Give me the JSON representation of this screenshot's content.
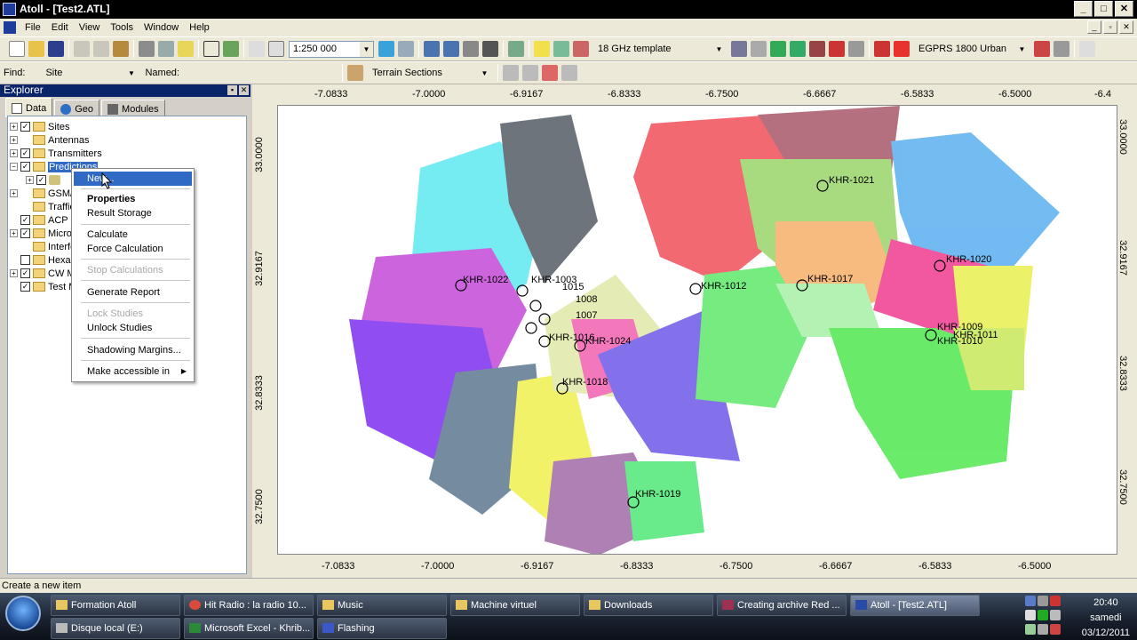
{
  "window": {
    "title": "Atoll - [Test2.ATL]",
    "buttons": [
      "_",
      "□",
      "✕"
    ]
  },
  "menubar": {
    "items": [
      "File",
      "Edit",
      "View",
      "Tools",
      "Window",
      "Help"
    ]
  },
  "toolbar1": {
    "scale_value": "1:250 000",
    "template_value": "18 GHz template",
    "network_value": "EGPRS 1800 Urban"
  },
  "toolbar2": {
    "find_label": "Find:",
    "find_value": "Site",
    "named_label": "Named:",
    "terrain_value": "Terrain Sections"
  },
  "explorer": {
    "title": "Explorer",
    "tabs": [
      "Data",
      "Geo",
      "Modules"
    ],
    "tree": [
      {
        "label": "Sites",
        "checked": true
      },
      {
        "label": "Antennas",
        "checked": false
      },
      {
        "label": "Transmitters",
        "checked": true
      },
      {
        "label": "Predictions",
        "checked": true,
        "selected": true
      },
      {
        "label": "",
        "checked": true
      },
      {
        "label": "GSM/GPRS/EGPRS Parameters",
        "checked": false
      },
      {
        "label": "Traffic Analysis",
        "checked": false
      },
      {
        "label": "ACP - Automatic Cell Planning",
        "checked": true
      },
      {
        "label": "Microwave Radio Links",
        "checked": true
      },
      {
        "label": "Interference Matrices",
        "checked": false
      },
      {
        "label": "Hexagonal Design",
        "checked": false
      },
      {
        "label": "CW Measurements",
        "checked": true
      },
      {
        "label": "Test Mobile Data",
        "checked": true
      }
    ]
  },
  "context_menu": {
    "items": [
      {
        "label": "New...",
        "state": "selected"
      },
      {
        "label": "Properties",
        "state": "bold"
      },
      {
        "label": "Result Storage",
        "state": "normal"
      },
      {
        "label": "Calculate",
        "state": "normal"
      },
      {
        "label": "Force Calculation",
        "state": "normal"
      },
      {
        "label": "Stop Calculations",
        "state": "disabled"
      },
      {
        "label": "Generate Report",
        "state": "normal"
      },
      {
        "label": "Lock Studies",
        "state": "disabled"
      },
      {
        "label": "Unlock Studies",
        "state": "normal"
      },
      {
        "label": "Shadowing Margins...",
        "state": "normal"
      },
      {
        "label": "Make accessible in",
        "state": "submenu"
      }
    ]
  },
  "map": {
    "top_ruler": [
      "-7.0833",
      "-7.0000",
      "-6.9167",
      "-6.8333",
      "-6.7500",
      "-6.6667",
      "-6.5833",
      "-6.5000",
      "-6.4"
    ],
    "bottom_ruler": [
      "-7.0833",
      "-7.0000",
      "-6.9167",
      "-6.8333",
      "-6.7500",
      "-6.6667",
      "-6.5833",
      "-6.5000"
    ],
    "left_ruler": [
      "33.0000",
      "32.9167",
      "32.8333",
      "32.7500"
    ],
    "right_ruler": [
      "33.0000",
      "32.9167",
      "32.8333",
      "32.7500"
    ],
    "site_labels": [
      "KHR-1021",
      "KHR-1020",
      "KHR-1022",
      "KHR-1003",
      "1015",
      "1008",
      "1007",
      "KHR-1012",
      "KHR-1017",
      "KHR-1009",
      "KHR-1011",
      "KHR-1010",
      "KHR-1016",
      "KHR-1024",
      "KHR-1018",
      "KHR-1019"
    ]
  },
  "statusbar": {
    "text": "Create a new item"
  },
  "taskbar": {
    "row1": [
      "Formation Atoll",
      "Hit Radio : la radio 10...",
      "Music",
      "Machine virtuel",
      "Downloads",
      "Creating archive Red ...",
      "Atoll - [Test2.ATL]"
    ],
    "row2": [
      "Disque local (E:)",
      "Microsoft Excel - Khrib...",
      "Flashing"
    ],
    "clock_time": "20:40",
    "clock_day": "samedi",
    "clock_date": "03/12/2011"
  }
}
